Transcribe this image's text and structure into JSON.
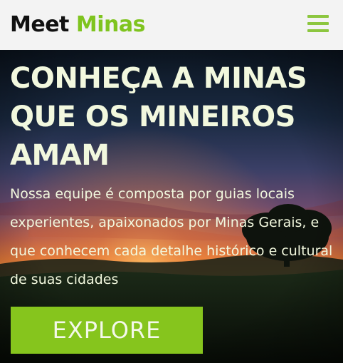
{
  "header": {
    "brand_first": "Meet",
    "brand_second": "Minas",
    "menu_icon": "hamburger-menu-icon"
  },
  "hero": {
    "headline": "CONHEÇA A MINAS QUE OS MINEIROS AMAM",
    "description": "Nossa equipe é composta por guias locais experientes, apaixonados por Minas Gerais, e que conhecem cada detalhe histórico e cultural de suas cidades",
    "cta_label": "EXPLORE"
  },
  "colors": {
    "accent_green": "#86c51d",
    "header_bg": "#f3f3f3",
    "hero_text": "#f2f8de"
  }
}
